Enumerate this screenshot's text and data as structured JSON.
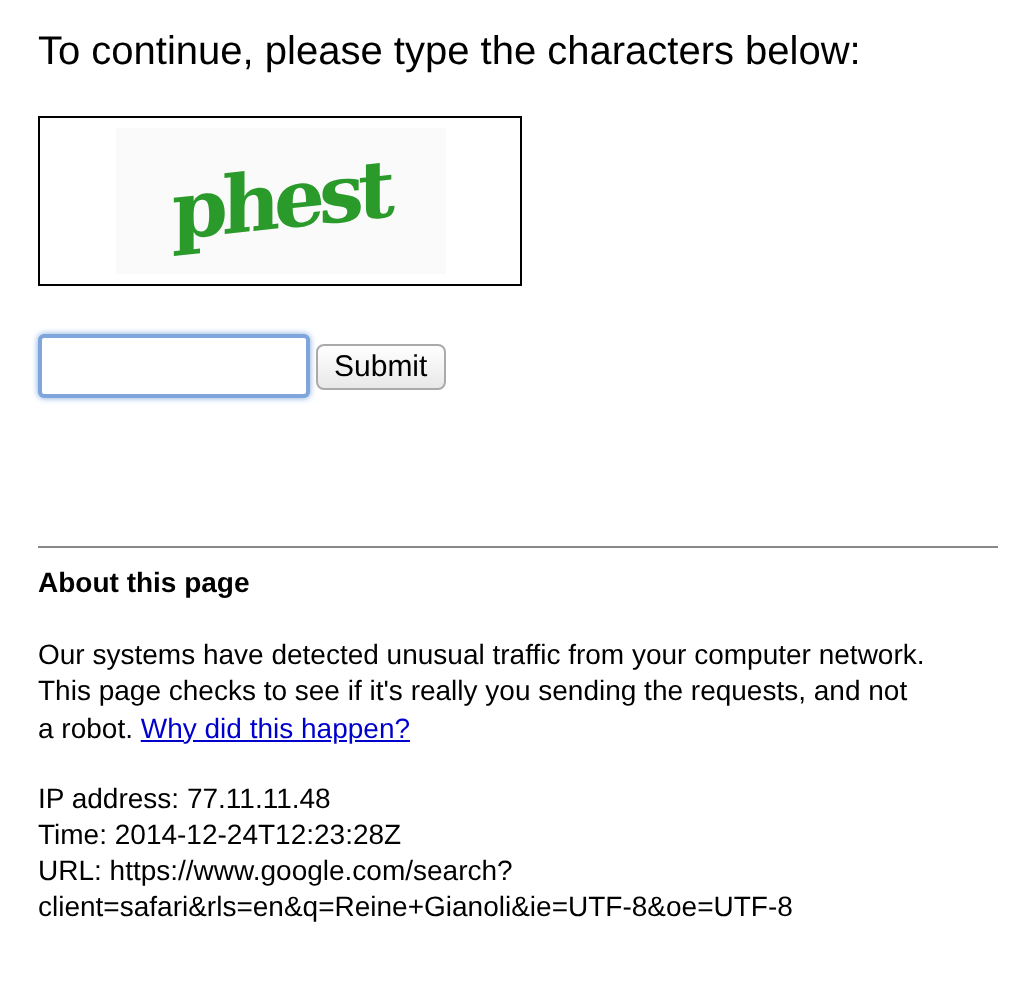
{
  "heading": "To continue, please type the characters below:",
  "captcha": {
    "text": "phest",
    "color": "#2a9a2a"
  },
  "answer": {
    "focused": true
  },
  "submit": "Submit",
  "about": {
    "title": "About this page",
    "paragraph": "Our systems have detected unusual traffic from your computer network. This page checks to see if it's really you sending the requests, and not a robot.",
    "link": "Why did this happen?",
    "info_lines": [
      "IP address: 77.11.11.48",
      "Time: 2014-12-24T12:23:28Z",
      "URL: https://www.google.com/search?",
      "client=safari&rls=en&q=Reine+Gianoli&ie=UTF-8&oe=UTF-8"
    ]
  }
}
